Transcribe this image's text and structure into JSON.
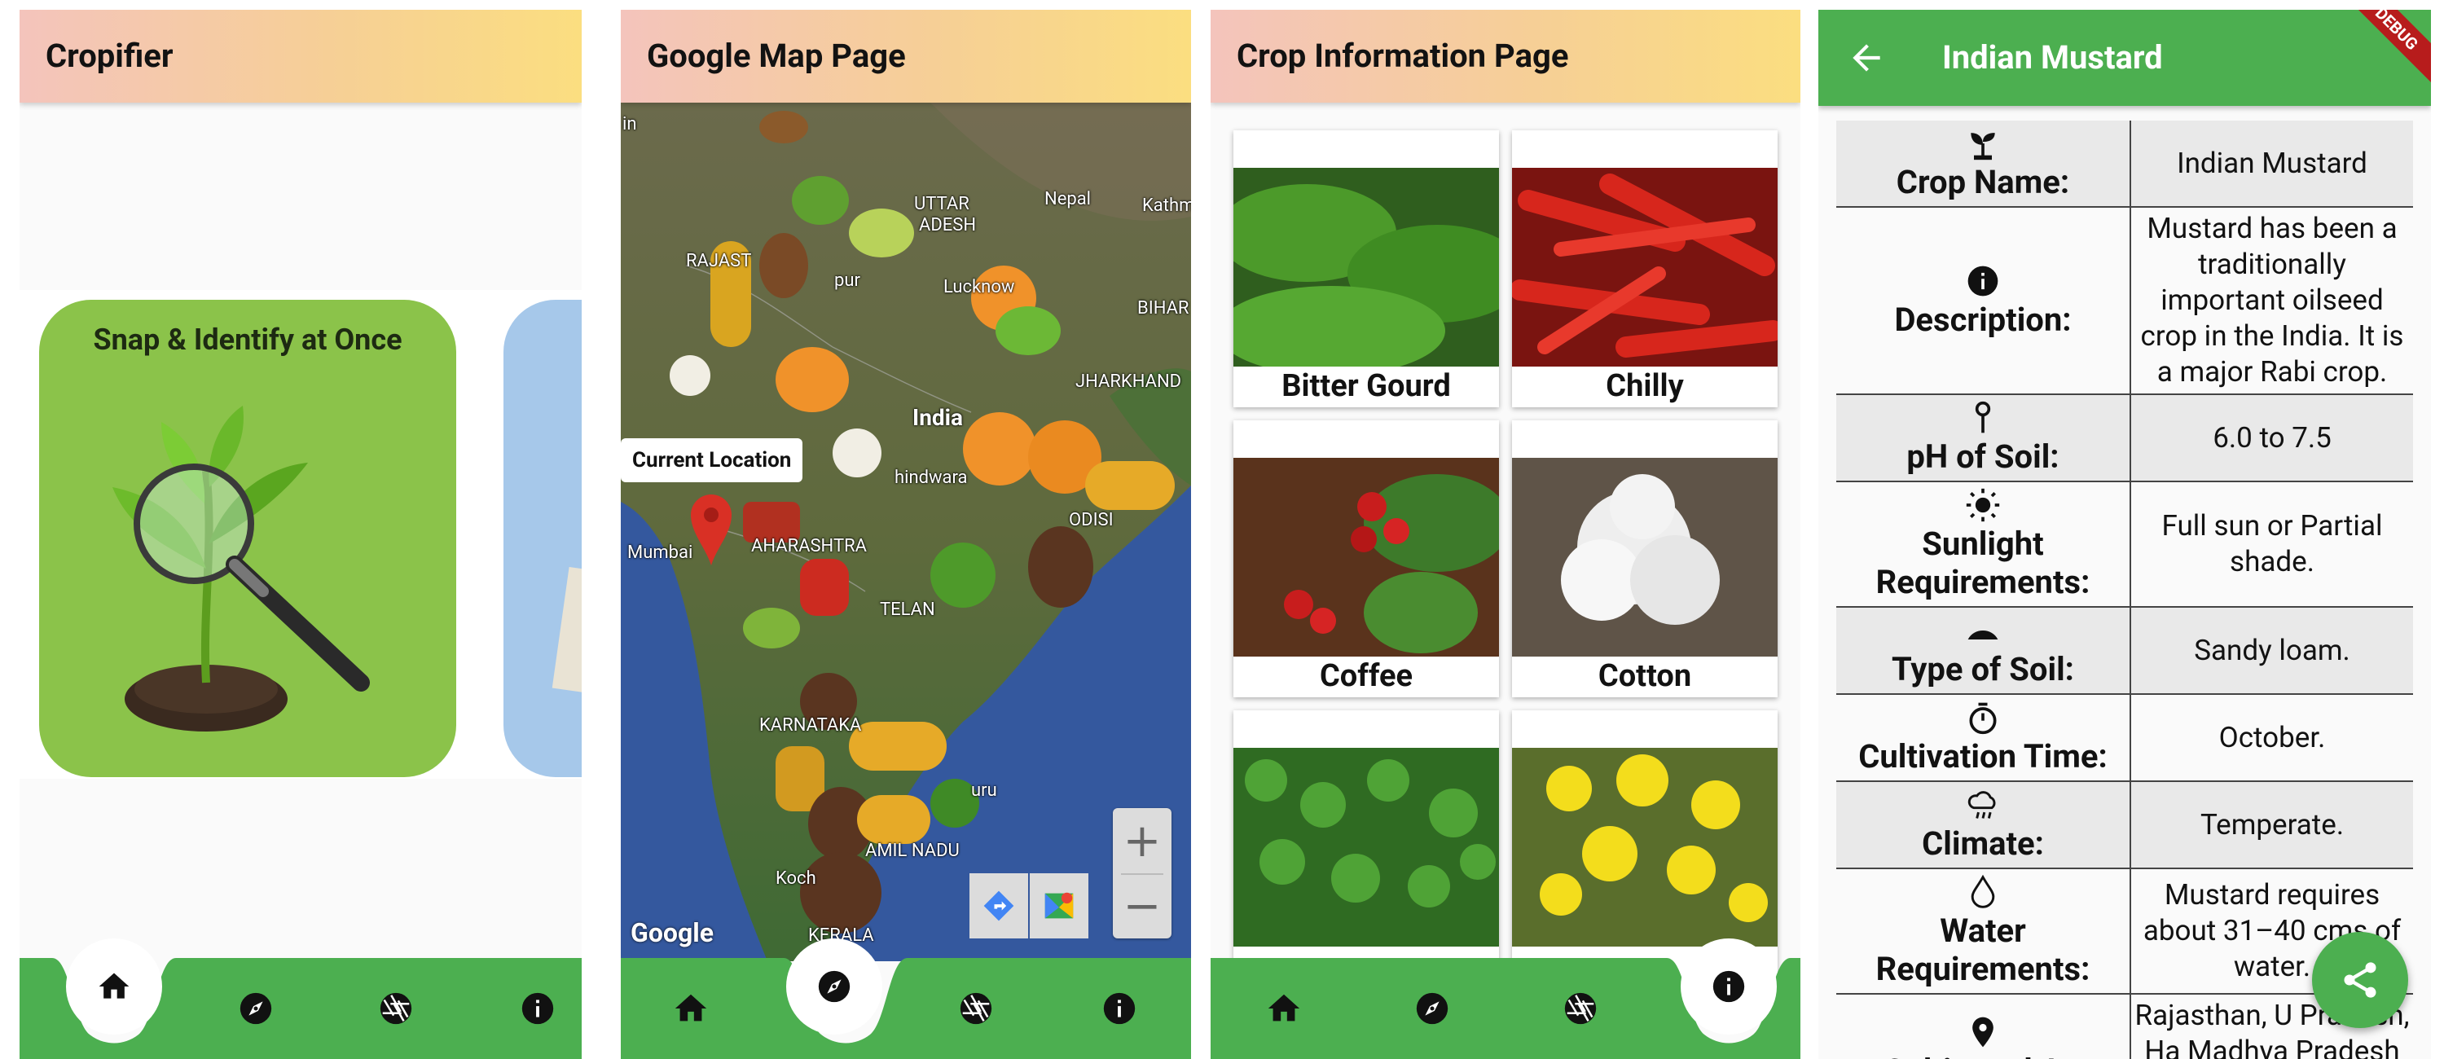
{
  "home_screen": {
    "app_title": "Cropifier",
    "banner_caption": "Snap & Identify at Once"
  },
  "map_screen": {
    "app_title": "Google Map Page",
    "current_location_label": "Current Location",
    "map_labels": [
      "Nepal",
      "Kathm",
      "UTTAR",
      "ADESH",
      "RAJAST",
      "Lucknow",
      "BIHAR",
      "pur",
      "India",
      "JHARKHAND",
      "hindwara",
      "ODISI",
      "Mumbai",
      "AHARASHTRA",
      "TELAN",
      "KARNATAKA",
      "uru",
      "AMIL NADU",
      "Koch",
      "KERALA",
      "in"
    ],
    "google_attribution": "Google",
    "zoom_in": "+",
    "zoom_out": "−"
  },
  "crop_screen": {
    "app_title": "Crop Information Page",
    "crops": [
      {
        "name": "Bitter Gourd"
      },
      {
        "name": "Chilly"
      },
      {
        "name": "Coffee"
      },
      {
        "name": "Cotton"
      },
      {
        "name": ""
      },
      {
        "name": ""
      }
    ]
  },
  "detail_screen": {
    "app_title": "Indian Mustard",
    "debug_banner": "DEBUG",
    "rows": [
      {
        "icon": "sprout-icon",
        "label": "Crop Name:",
        "value": "Indian Mustard"
      },
      {
        "icon": "info-icon",
        "label": "Description:",
        "value": "Mustard has been a traditionally important oilseed crop in the India. It is a major Rabi crop."
      },
      {
        "icon": "ph-probe-icon",
        "label": "pH of Soil:",
        "value": "6.0 to 7.5"
      },
      {
        "icon": "sun-icon",
        "label": "Sunlight Requirements:",
        "value": "Full sun or Partial shade."
      },
      {
        "icon": "soil-pile-icon",
        "label": "Type of Soil:",
        "value": "Sandy loam."
      },
      {
        "icon": "timer-icon",
        "label": "Cultivation Time:",
        "value": "October."
      },
      {
        "icon": "climate-icon",
        "label": "Climate:",
        "value": "Temperate."
      },
      {
        "icon": "water-drop-icon",
        "label": "Water Requirements:",
        "value": "Mustard requires about 31–40 cms of water."
      },
      {
        "icon": "location-pin-icon",
        "label": "Cultivated At:",
        "value": "Rajasthan, U Pradesh, Ha Madhya Pradesh and Gujarat"
      }
    ]
  },
  "colors": {
    "nav_green": "#4caf50",
    "appbar_gradient_start": "#f4c4bc",
    "appbar_gradient_end": "#fbde80"
  },
  "nav_icons": [
    "home-icon",
    "compass-icon",
    "camera-aperture-icon",
    "info-icon"
  ]
}
